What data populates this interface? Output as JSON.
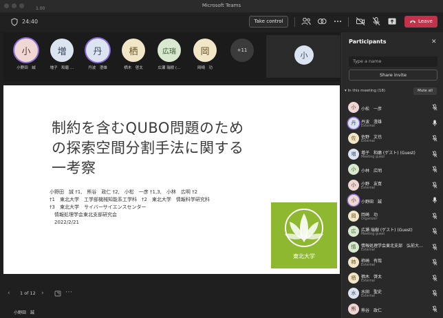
{
  "window": {
    "title": "Microsoft Teams",
    "zoom": "1.00"
  },
  "toolbar": {
    "timer": "24:40",
    "take_control": "Take control",
    "leave": "Leave",
    "colors": {
      "leave_bg": "#c4314b",
      "accent": "#8b6cd6"
    }
  },
  "video_tiles": [
    {
      "initial": "小",
      "name": "小野田　誠",
      "bg": "#efd7d3",
      "fg": "#5d3a36",
      "ring": true
    },
    {
      "initial": "増",
      "name": "増子　和磨 …",
      "bg": "#dbe4f0",
      "fg": "#3b4a60",
      "ring": false
    },
    {
      "initial": "丹",
      "name": "丹波　澄雄",
      "bg": "#dbe4f0",
      "fg": "#3b4a60",
      "ring": true
    },
    {
      "initial": "栖",
      "name": "栖木　啓太",
      "bg": "#f2e6c8",
      "fg": "#6a5224",
      "ring": false
    },
    {
      "initial": "広瑞",
      "name": "広瀬 瑞樹 (…",
      "bg": "#d8e9cf",
      "fg": "#3d5a2f",
      "ring": false
    },
    {
      "initial": "岡",
      "name": "岡崎　功",
      "bg": "#f2e6c8",
      "fg": "#6a5224",
      "ring": false
    }
  ],
  "overflow_count": "+11",
  "self_view_initial": "小",
  "slide": {
    "title_lines": [
      "制約を含むQUBO問題のため",
      "の探索空間分割手法に関する",
      "一考察"
    ],
    "author_lines": [
      "小野田　誠 †1,　熊谷　政仁 †2,　小松　一彦 †1,3,　小林　広明 †2",
      "†1　東北大学　工学部機械知能系工学科　†2　東北大学　情報科学研究科",
      "†3　東北大学　サイバーサイエンスセンター",
      "　情報処理学会東北支部研究会",
      "　2022/2/21"
    ],
    "logo_text": "東北大学",
    "logo_color": "#8eb830"
  },
  "nav": {
    "page_indicator": "1 of 12"
  },
  "presenter_name": "小野田　誠",
  "panel": {
    "title": "Participants",
    "search_placeholder": "Type a name",
    "share_invite": "Share invite",
    "in_meeting": "In this meeting (18)",
    "mute_all": "Mute all",
    "participants": [
      {
        "initial": "小",
        "name": "小松　一彦",
        "sub": "",
        "bg": "#efd7d3",
        "fg": "#5d3a36",
        "mic": "muted"
      },
      {
        "initial": "丹",
        "name": "丹波　澄雄",
        "sub": "External",
        "bg": "#dbe4f0",
        "fg": "#3b4a60",
        "mic": "on"
      },
      {
        "initial": "佐",
        "name": "佐野　文也",
        "sub": "External",
        "bg": "#f2e6c8",
        "fg": "#6a5224",
        "mic": "muted"
      },
      {
        "initial": "増",
        "name": "増子　和磨 (ゲスト) (Guest)",
        "sub": "Meeting guest",
        "bg": "#dbe4f0",
        "fg": "#3b4a60",
        "mic": "muted"
      },
      {
        "initial": "小",
        "name": "小林　広明",
        "sub": "",
        "bg": "#d8e9cf",
        "fg": "#3d5a2f",
        "mic": "muted"
      },
      {
        "initial": "小",
        "name": "小野　友寛",
        "sub": "External",
        "bg": "#efd7d3",
        "fg": "#5d3a36",
        "mic": "muted"
      },
      {
        "initial": "小",
        "name": "小野田　誠",
        "sub": "",
        "bg": "#efd7d3",
        "fg": "#5d3a36",
        "mic": "on"
      },
      {
        "initial": "岡",
        "name": "岡崎　功",
        "sub": "Organizer",
        "bg": "#f2e6c8",
        "fg": "#6a5224",
        "mic": "muted"
      },
      {
        "initial": "広",
        "name": "広瀬 瑞樹 (ゲスト) (Guest)",
        "sub": "Meeting guest",
        "bg": "#d8e9cf",
        "fg": "#3d5a2f",
        "mic": "muted"
      },
      {
        "initial": "情",
        "name": "情報処理学会東北支部　弘前大…",
        "sub": "External",
        "bg": "#d8e9cf",
        "fg": "#3d5a2f",
        "mic": "muted"
      },
      {
        "initial": "柿",
        "name": "柿崎　有哉",
        "sub": "External",
        "bg": "#f2e6c8",
        "fg": "#6a5224",
        "mic": "muted"
      },
      {
        "initial": "栖",
        "name": "栖木　啓太",
        "sub": "External",
        "bg": "#f2e6c8",
        "fg": "#6a5224",
        "mic": "muted"
      },
      {
        "initial": "水",
        "name": "水田　聖史",
        "sub": "External",
        "bg": "#dbe4f0",
        "fg": "#3b4a60",
        "mic": "muted"
      },
      {
        "initial": "熊",
        "name": "熊谷　政仁",
        "sub": "",
        "bg": "#efd7d3",
        "fg": "#5d3a36",
        "mic": "muted"
      }
    ]
  }
}
